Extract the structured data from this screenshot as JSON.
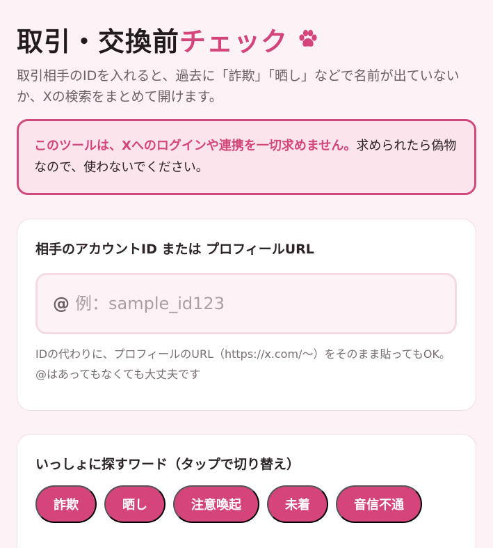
{
  "header": {
    "title_main": "取引・交換前",
    "title_accent": "チェック",
    "subtitle": "取引相手のIDを入れると、過去に「詐欺」「晒し」などで名前が出ていないか、Xの検索をまとめて開けます。"
  },
  "warning": {
    "strong": "このツールは、Xへのログインや連携を一切求めません。",
    "rest": "求められたら偽物なので、使わないでください。"
  },
  "account": {
    "label": "相手のアカウントID または プロフィールURL",
    "at_prefix": "@",
    "placeholder": "例：sample_id123",
    "value": "",
    "hint": "IDの代わりに、プロフィールのURL（https://x.com/〜）をそのまま貼ってもOK。@はあってもなくても大丈夫です"
  },
  "words": {
    "label": "いっしょに探すワード（タップで切り替え）",
    "chips": [
      {
        "label": "詐欺"
      },
      {
        "label": "晒し"
      },
      {
        "label": "注意喚起"
      },
      {
        "label": "未着"
      },
      {
        "label": "音信不通"
      }
    ]
  },
  "colors": {
    "accent": "#d3457b",
    "background": "#fdf3f6",
    "warning_bg": "#fce4ec"
  },
  "icons": {
    "title_icon": "paw-icon"
  }
}
